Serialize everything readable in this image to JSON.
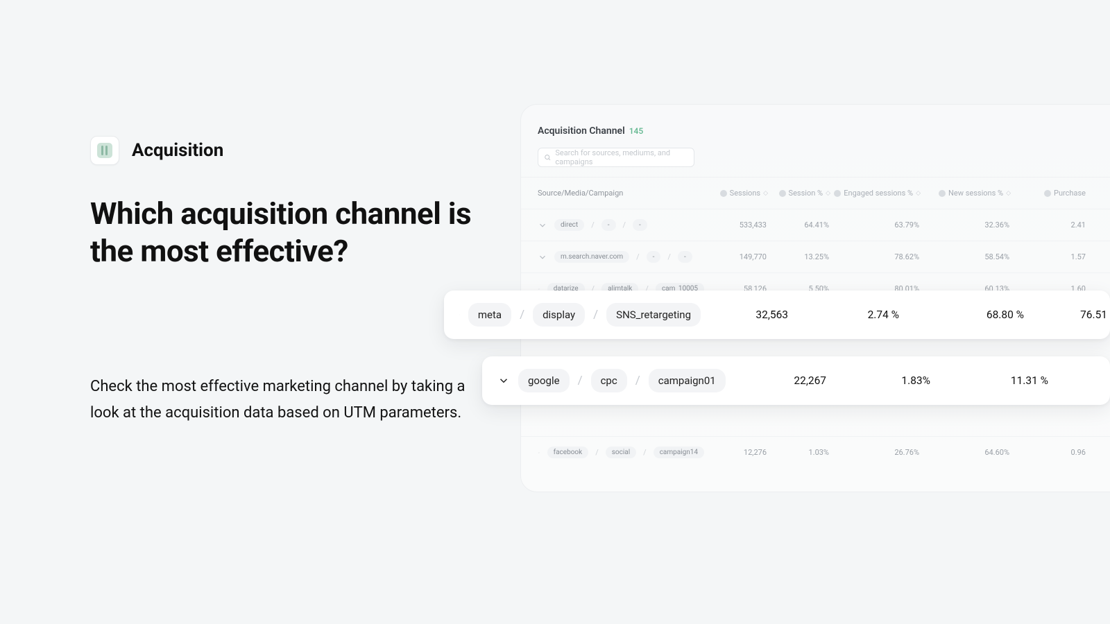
{
  "section_label": "Acquisition",
  "headline": "Which acquisition channel is the most effective?",
  "subtext": "Check the most effective marketing channel by taking a look at the acquisition data based on UTM parameters.",
  "panel": {
    "title": "Acquisition Channel",
    "count": "145",
    "search_placeholder": "Search for sources, mediums, and campaigns"
  },
  "columns": {
    "src": "Source/Media/Campaign",
    "sessions": "Sessions",
    "session_pct": "Session %",
    "engaged_pct": "Engaged sessions %",
    "new_pct": "New sessions %",
    "purchase": "Purchase"
  },
  "rows": [
    {
      "src": [
        "direct",
        "-",
        "-"
      ],
      "vals": [
        "533,433",
        "64.41%",
        "63.79%",
        "32.36%",
        "2.41"
      ]
    },
    {
      "src": [
        "m.search.naver.com",
        "-",
        "-"
      ],
      "vals": [
        "149,770",
        "13.25%",
        "78.62%",
        "58.54%",
        "1.57"
      ]
    },
    {
      "src": [
        "datarize",
        "alimtalk",
        "cam_10005"
      ],
      "vals": [
        "58,126",
        "5.50%",
        "80.01%",
        "60.13%",
        "1.60"
      ]
    },
    {
      "src": [
        "facebook",
        "social",
        "campaign14"
      ],
      "vals": [
        "12,276",
        "1.03%",
        "26.76%",
        "64.60%",
        "0.96"
      ]
    }
  ],
  "highlight": [
    {
      "src": [
        "meta",
        "display",
        "SNS_retargeting"
      ],
      "vals": [
        "32,563",
        "2.74 %",
        "68.80 %",
        "76.51"
      ]
    },
    {
      "src": [
        "google",
        "cpc",
        "campaign01"
      ],
      "vals": [
        "22,267",
        "1.83%",
        "11.31 %",
        ""
      ]
    }
  ]
}
